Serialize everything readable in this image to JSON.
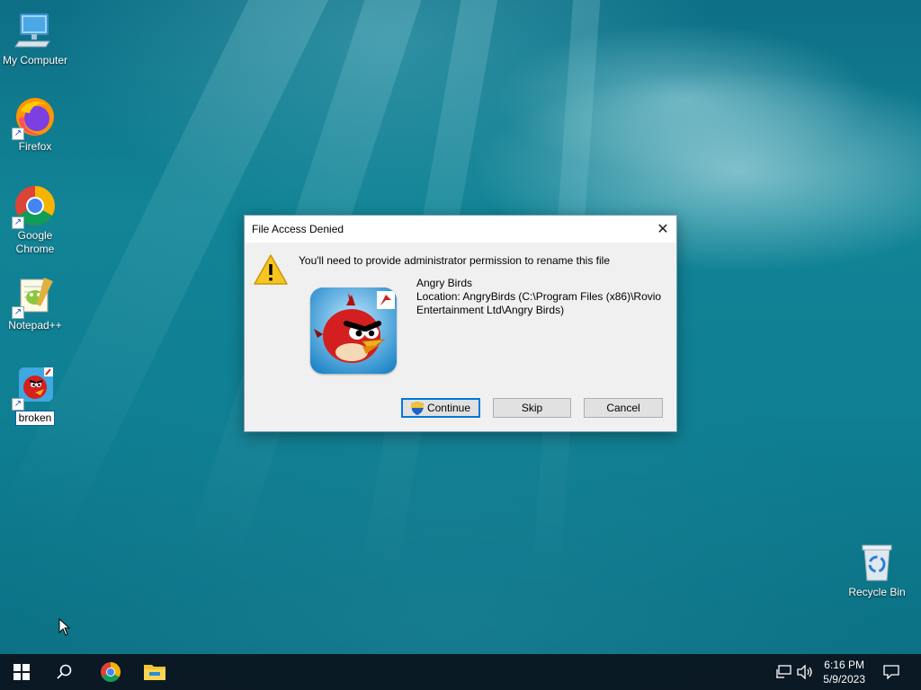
{
  "desktop": {
    "icons": [
      {
        "label": "My Computer",
        "icon": "computer-icon"
      },
      {
        "label": "Firefox",
        "icon": "firefox-icon"
      },
      {
        "label": "Google Chrome",
        "icon": "chrome-icon"
      },
      {
        "label": "Notepad++",
        "icon": "notepadpp-icon"
      },
      {
        "label": "broken",
        "icon": "angry-birds-icon"
      },
      {
        "label": "Recycle Bin",
        "icon": "recycle-bin-icon"
      }
    ]
  },
  "dialog": {
    "title": "File Access Denied",
    "message": "You'll need to provide administrator permission to rename this file",
    "file_name": "Angry Birds",
    "location_line1": "Location: AngryBirds (C:\\Program Files (x86)\\Rovio",
    "location_line2": "Entertainment Ltd\\Angry Birds)",
    "buttons": {
      "continue": "Continue",
      "skip": "Skip",
      "cancel": "Cancel"
    }
  },
  "taskbar": {
    "time": "6:16 PM",
    "date": "5/9/2023"
  }
}
